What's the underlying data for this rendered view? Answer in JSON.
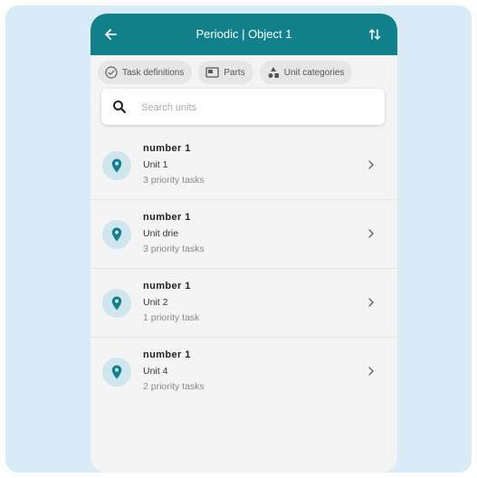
{
  "header": {
    "title": "Periodic | Object 1"
  },
  "chips": [
    {
      "label": "Task definitions",
      "icon": "check-circle-icon"
    },
    {
      "label": "Parts",
      "icon": "card-icon"
    },
    {
      "label": "Unit categories",
      "icon": "shapes-icon"
    }
  ],
  "search": {
    "placeholder": "Search units",
    "value": ""
  },
  "units": [
    {
      "number": "number 1",
      "name": "Unit 1",
      "tasks": "3 priority tasks"
    },
    {
      "number": "number 1",
      "name": "Unit drie",
      "tasks": "3 priority tasks"
    },
    {
      "number": "number 1",
      "name": "Unit 2",
      "tasks": "1 priority task"
    },
    {
      "number": "number 1",
      "name": "Unit 4",
      "tasks": "2 priority tasks"
    }
  ],
  "colors": {
    "primary": "#10808a",
    "background": "#d9ebf6",
    "avatar_bg": "#cfe6ee"
  }
}
